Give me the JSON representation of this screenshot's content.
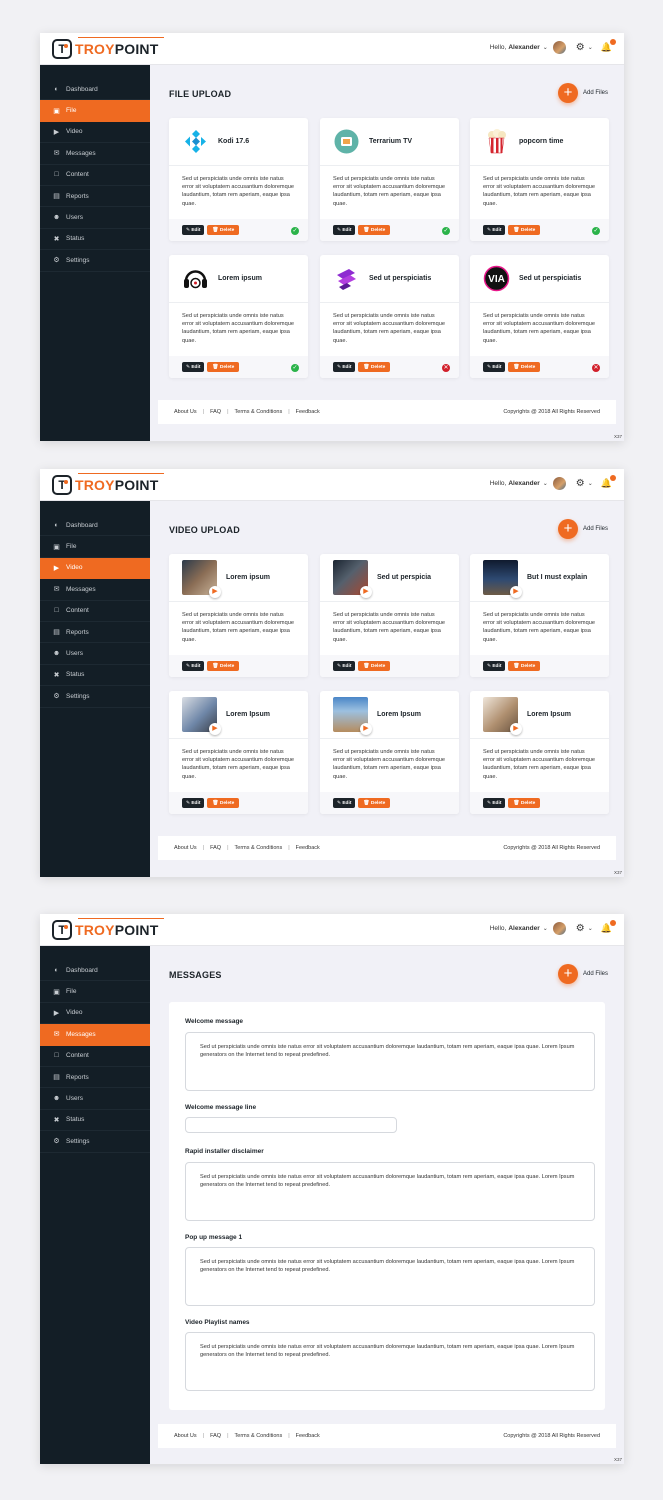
{
  "brand": {
    "troy": "TROY",
    "point": "POINT",
    "logo_letter": "T"
  },
  "header": {
    "greeting": "Hello,",
    "user_name": "Alexander"
  },
  "nav": [
    {
      "label": "Dashboard",
      "icon": "dashboard-icon"
    },
    {
      "label": "File",
      "icon": "file-icon"
    },
    {
      "label": "Video",
      "icon": "video-icon"
    },
    {
      "label": "Messages",
      "icon": "messages-icon"
    },
    {
      "label": "Content",
      "icon": "content-icon"
    },
    {
      "label": "Reports",
      "icon": "reports-icon"
    },
    {
      "label": "Users",
      "icon": "users-icon"
    },
    {
      "label": "Status",
      "icon": "status-icon"
    },
    {
      "label": "Settings",
      "icon": "settings-icon"
    }
  ],
  "add_files_label": "Add Files",
  "body_text": "Sed ut perspiciatis unde omnis iste natus error sit voluptatem accusantium doloremque laudantium, totam rem aperiam, eaque ipsa quae.",
  "edit_label": "Edit",
  "delete_label": "Delete",
  "footer": {
    "about": "About Us",
    "faq": "FAQ",
    "terms": "Terms & Conditions",
    "feedback": "Feedback",
    "copyright": "Copyrights @ 2018 All Rights Reserved"
  },
  "code": "X37",
  "file_page": {
    "title": "FILE UPLOAD",
    "cards": [
      {
        "title": "Kodi 17.6",
        "status": "ok"
      },
      {
        "title": "Terrarium TV",
        "status": "ok"
      },
      {
        "title": "popcorn time",
        "status": "ok"
      },
      {
        "title": "Lorem ipsum",
        "status": "ok"
      },
      {
        "title": "Sed ut perspiciatis",
        "status": "error"
      },
      {
        "title": "Sed ut perspiciatis",
        "status": "error"
      }
    ],
    "logo_texts": {
      "via": "VIA"
    }
  },
  "video_page": {
    "title": "VIDEO UPLOAD",
    "cards": [
      {
        "title": "Lorem ipsum"
      },
      {
        "title": "Sed ut perspicia"
      },
      {
        "title": "But I must explain"
      },
      {
        "title": "Lorem Ipsum"
      },
      {
        "title": "Lorem Ipsum"
      },
      {
        "title": "Lorem Ipsum"
      }
    ]
  },
  "messages_page": {
    "title": "MESSAGES",
    "fields": [
      {
        "label": "Welcome message",
        "value": "Sed ut perspiciatis unde omnis iste natus error sit voluptatem accusantium doloremque laudantium, totam rem aperiam, eaque ipsa quae. Lorem Ipsum generators on the Internet tend to repeat predefined."
      },
      {
        "label": "Welcome message line",
        "value": ""
      },
      {
        "label": "Rapid installer disclaimer",
        "value": "Sed ut perspiciatis unde omnis iste natus error sit voluptatem accusantium doloremque laudantium, totam rem aperiam, eaque ipsa quae. Lorem Ipsum generators on the Internet tend to repeat predefined."
      },
      {
        "label": "Pop up message 1",
        "value": "Sed ut perspiciatis unde omnis iste natus error sit voluptatem accusantium doloremque laudantium, totam rem aperiam, eaque ipsa quae. Lorem Ipsum generators on the Internet tend to repeat predefined."
      },
      {
        "label": "Video Playlist names",
        "value": "Sed ut perspiciatis unde omnis iste natus error sit voluptatem accusantium doloremque laudantium, totam rem aperiam, eaque ipsa quae. Lorem Ipsum generators on the Internet tend to repeat predefined."
      }
    ]
  },
  "colors": {
    "accent": "#ef6a21",
    "sidebar": "#131e26",
    "success": "#2bb34a",
    "error": "#d11f2a"
  }
}
